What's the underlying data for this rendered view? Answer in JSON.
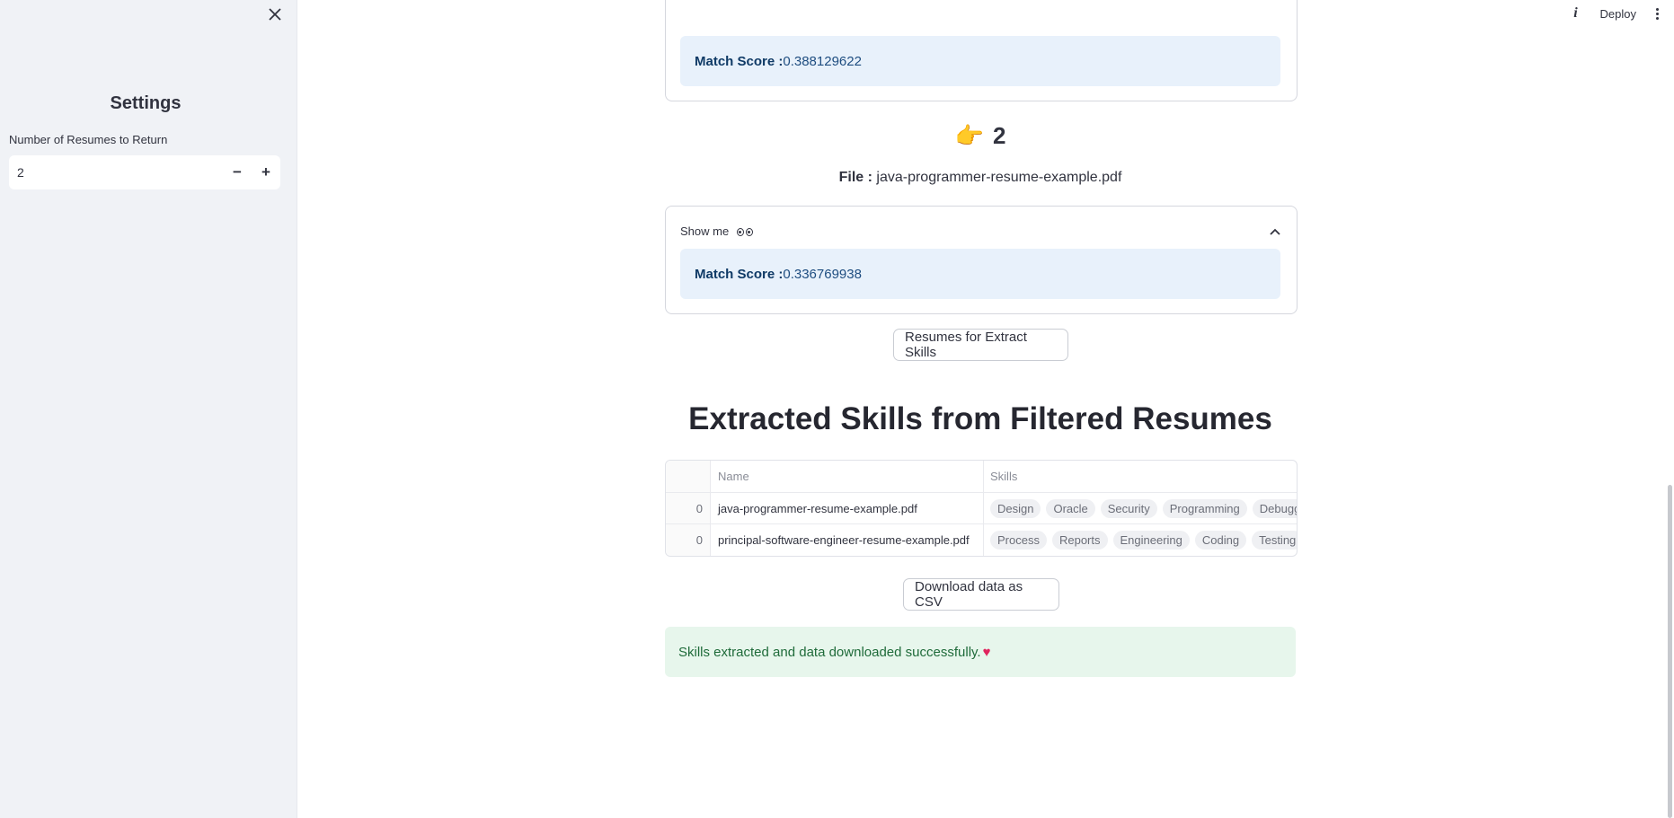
{
  "sidebar": {
    "title": "Settings",
    "resume_count_label": "Number of Resumes to Return",
    "resume_count_value": "2",
    "decrement_symbol": "−",
    "increment_symbol": "+"
  },
  "toolbar": {
    "info_symbol": "i",
    "deploy_label": "Deploy"
  },
  "top_card": {
    "match_label": "Match Score :",
    "match_value": " 0.388129622"
  },
  "result_2": {
    "rank_emoji": "👉",
    "rank_number": "2",
    "file_label": "File :",
    "file_value": " java-programmer-resume-example.pdf",
    "expander_label": "Show me",
    "match_label": "Match Score :",
    "match_value": " 0.336769938"
  },
  "buttons": {
    "extract_label": "Resumes for Extract Skills",
    "download_label": "Download data as CSV"
  },
  "section_title": "Extracted Skills from Filtered Resumes",
  "table": {
    "columns": [
      "",
      "Name",
      "Skills"
    ],
    "rows": [
      {
        "index": "0",
        "name": "java-programmer-resume-example.pdf",
        "skills": [
          "Design",
          "Oracle",
          "Security",
          "Programming",
          "Debugg"
        ]
      },
      {
        "index": "0",
        "name": "principal-software-engineer-resume-example.pdf",
        "skills": [
          "Process",
          "Reports",
          "Engineering",
          "Coding",
          "Testing"
        ]
      }
    ]
  },
  "success_message": "Skills extracted and data downloaded successfully.",
  "colors": {
    "sidebar_bg": "#f0f2f6",
    "info_bg": "#e8f1fb",
    "success_bg": "#e7f6ec",
    "heart": "#e0245e"
  }
}
